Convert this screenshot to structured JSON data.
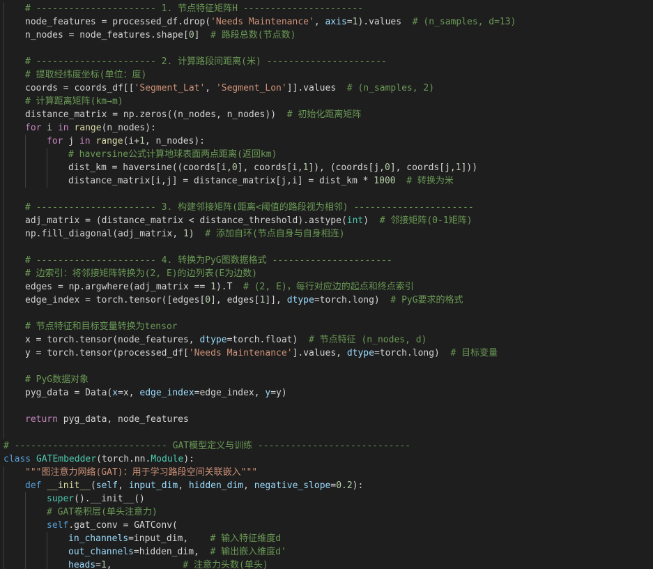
{
  "lines": [
    [
      0,
      [
        "c",
        "# ---------------------- 1. 节点特征矩阵H ----------------------"
      ]
    ],
    [
      0,
      [
        "",
        "node_features = processed_df.drop("
      ],
      [
        "s",
        "'Needs Maintenance'"
      ],
      [
        "",
        ", "
      ],
      [
        "v",
        "axis"
      ],
      [
        "",
        "="
      ],
      [
        "n",
        "1"
      ],
      [
        "",
        ").values  "
      ],
      [
        "c",
        "# (n_samples, d=13)"
      ]
    ],
    [
      0,
      [
        "",
        "n_nodes = node_features.shape["
      ],
      [
        "n",
        "0"
      ],
      [
        "",
        "]  "
      ],
      [
        "c",
        "# 路段总数(节点数)"
      ]
    ],
    [
      0,
      [
        "",
        ""
      ]
    ],
    [
      0,
      [
        "c",
        "# ---------------------- 2. 计算路段间距离(米) ----------------------"
      ]
    ],
    [
      0,
      [
        "c",
        "# 提取经纬度坐标(单位：度)"
      ]
    ],
    [
      0,
      [
        "",
        "coords = coords_df[["
      ],
      [
        "s",
        "'Segment_Lat'"
      ],
      [
        "",
        ", "
      ],
      [
        "s",
        "'Segment_Lon'"
      ],
      [
        "",
        "]].values  "
      ],
      [
        "c",
        "# (n_samples, 2)"
      ]
    ],
    [
      0,
      [
        "c",
        "# 计算距离矩阵(km→m)"
      ]
    ],
    [
      0,
      [
        "",
        "distance_matrix = np.zeros(("
      ],
      [
        "",
        "n_nodes, n_nodes))  "
      ],
      [
        "c",
        "# 初始化距离矩阵"
      ]
    ],
    [
      0,
      [
        "kf",
        "for"
      ],
      [
        "",
        " i "
      ],
      [
        "kf",
        "in"
      ],
      [
        "",
        " "
      ],
      [
        "fn",
        "range"
      ],
      [
        "",
        "(n_nodes):"
      ]
    ],
    [
      1,
      [
        "kf",
        "for"
      ],
      [
        "",
        " j "
      ],
      [
        "kf",
        "in"
      ],
      [
        "",
        " "
      ],
      [
        "fn",
        "range"
      ],
      [
        "",
        "(i+"
      ],
      [
        "n",
        "1"
      ],
      [
        "",
        ", n_nodes):"
      ]
    ],
    [
      2,
      [
        "c",
        "# haversine公式计算地球表面两点距离(返回km)"
      ]
    ],
    [
      2,
      [
        "",
        "dist_km = haversine(("
      ],
      [
        "",
        "coords[i,"
      ],
      [
        "n",
        "0"
      ],
      [
        "",
        "], coords[i,"
      ],
      [
        "n",
        "1"
      ],
      [
        "",
        "]), (coords[j,"
      ],
      [
        "n",
        "0"
      ],
      [
        "",
        "], coords[j,"
      ],
      [
        "n",
        "1"
      ],
      [
        "",
        "]))"
      ]
    ],
    [
      2,
      [
        "",
        "distance_matrix[i,j] = distance_matrix[j,i] = dist_km * "
      ],
      [
        "n",
        "1000"
      ],
      [
        "",
        "  "
      ],
      [
        "c",
        "# 转换为米"
      ]
    ],
    [
      0,
      [
        "",
        ""
      ]
    ],
    [
      0,
      [
        "c",
        "# ---------------------- 3. 构建邻接矩阵(距离<阈值的路段视为相邻) ----------------------"
      ]
    ],
    [
      0,
      [
        "",
        "adj_matrix = (distance_matrix < distance_threshold).astype("
      ],
      [
        "t",
        "int"
      ],
      [
        "",
        ")  "
      ],
      [
        "c",
        "# 邻接矩阵(0-1矩阵)"
      ]
    ],
    [
      0,
      [
        "",
        "np.fill_diagonal(adj_matrix, "
      ],
      [
        "n",
        "1"
      ],
      [
        "",
        ")  "
      ],
      [
        "c",
        "# 添加自环(节点自身与自身相连)"
      ]
    ],
    [
      0,
      [
        "",
        ""
      ]
    ],
    [
      0,
      [
        "c",
        "# ---------------------- 4. 转换为PyG图数据格式 ----------------------"
      ]
    ],
    [
      0,
      [
        "c",
        "# 边索引：将邻接矩阵转换为(2, E)的边列表(E为边数)"
      ]
    ],
    [
      0,
      [
        "",
        "edges = np.argwhere(adj_matrix == "
      ],
      [
        "n",
        "1"
      ],
      [
        "",
        ").T  "
      ],
      [
        "c",
        "# (2, E)，每行对应边的起点和终点索引"
      ]
    ],
    [
      0,
      [
        "",
        "edge_index = torch.tensor([edges["
      ],
      [
        "n",
        "0"
      ],
      [
        "",
        "], edges["
      ],
      [
        "n",
        "1"
      ],
      [
        "",
        "]], "
      ],
      [
        "v",
        "dtype"
      ],
      [
        "",
        "=torch.long)  "
      ],
      [
        "c",
        "# PyG要求的格式"
      ]
    ],
    [
      0,
      [
        "",
        ""
      ]
    ],
    [
      0,
      [
        "c",
        "# 节点特征和目标变量转换为tensor"
      ]
    ],
    [
      0,
      [
        "",
        "x = torch.tensor(node_features, "
      ],
      [
        "v",
        "dtype"
      ],
      [
        "",
        "=torch.float)  "
      ],
      [
        "c",
        "# 节点特征 (n_nodes, d)"
      ]
    ],
    [
      0,
      [
        "",
        "y = torch.tensor(processed_df["
      ],
      [
        "s",
        "'Needs Maintenance'"
      ],
      [
        "",
        "].values, "
      ],
      [
        "v",
        "dtype"
      ],
      [
        "",
        "=torch.long)  "
      ],
      [
        "c",
        "# 目标变量"
      ]
    ],
    [
      0,
      [
        "",
        ""
      ]
    ],
    [
      0,
      [
        "c",
        "# PyG数据对象"
      ]
    ],
    [
      0,
      [
        "",
        "pyg_data = Data("
      ],
      [
        "v",
        "x"
      ],
      [
        "",
        "=x, "
      ],
      [
        "v",
        "edge_index"
      ],
      [
        "",
        "=edge_index, "
      ],
      [
        "v",
        "y"
      ],
      [
        "",
        "=y)"
      ]
    ],
    [
      0,
      [
        "",
        ""
      ]
    ],
    [
      0,
      [
        "kf",
        "return"
      ],
      [
        "",
        " pyg_data, node_features"
      ]
    ],
    [
      0,
      [
        "",
        ""
      ]
    ],
    [
      -1,
      [
        "c",
        "# ---------------------------- GAT模型定义与训练 ----------------------------"
      ]
    ],
    [
      -1,
      [
        "k",
        "class"
      ],
      [
        "",
        " "
      ],
      [
        "t",
        "GATEmbedder"
      ],
      [
        "",
        "(torch.nn."
      ],
      [
        "t",
        "Module"
      ],
      [
        "",
        "):"
      ]
    ],
    [
      0,
      [
        "s",
        "\"\"\"图注意力网络(GAT)：用于学习路段空间关联嵌入\"\"\""
      ]
    ],
    [
      0,
      [
        "k",
        "def"
      ],
      [
        "",
        " "
      ],
      [
        "fn",
        "__init__"
      ],
      [
        "",
        "("
      ],
      [
        "v",
        "self"
      ],
      [
        "",
        ", "
      ],
      [
        "v",
        "input_dim"
      ],
      [
        "",
        ", "
      ],
      [
        "v",
        "hidden_dim"
      ],
      [
        "",
        ", "
      ],
      [
        "v",
        "negative_slope"
      ],
      [
        "",
        "="
      ],
      [
        "n",
        "0.2"
      ],
      [
        "",
        "):"
      ]
    ],
    [
      1,
      [
        "t",
        "super"
      ],
      [
        "",
        "().__init__()"
      ]
    ],
    [
      1,
      [
        "c",
        "# GAT卷积层(单头注意力)"
      ]
    ],
    [
      1,
      [
        "k",
        "self"
      ],
      [
        "",
        ".gat_conv = GATConv("
      ]
    ],
    [
      2,
      [
        "v",
        "in_channels"
      ],
      [
        "",
        "=input_dim,    "
      ],
      [
        "c",
        "# 输入特征维度d"
      ]
    ],
    [
      2,
      [
        "v",
        "out_channels"
      ],
      [
        "",
        "=hidden_dim,  "
      ],
      [
        "c",
        "# 输出嵌入维度d'"
      ]
    ],
    [
      2,
      [
        "v",
        "heads"
      ],
      [
        "",
        "="
      ],
      [
        "n",
        "1"
      ],
      [
        "",
        ",             "
      ],
      [
        "c",
        "# 注意力头数(单头)"
      ]
    ]
  ]
}
